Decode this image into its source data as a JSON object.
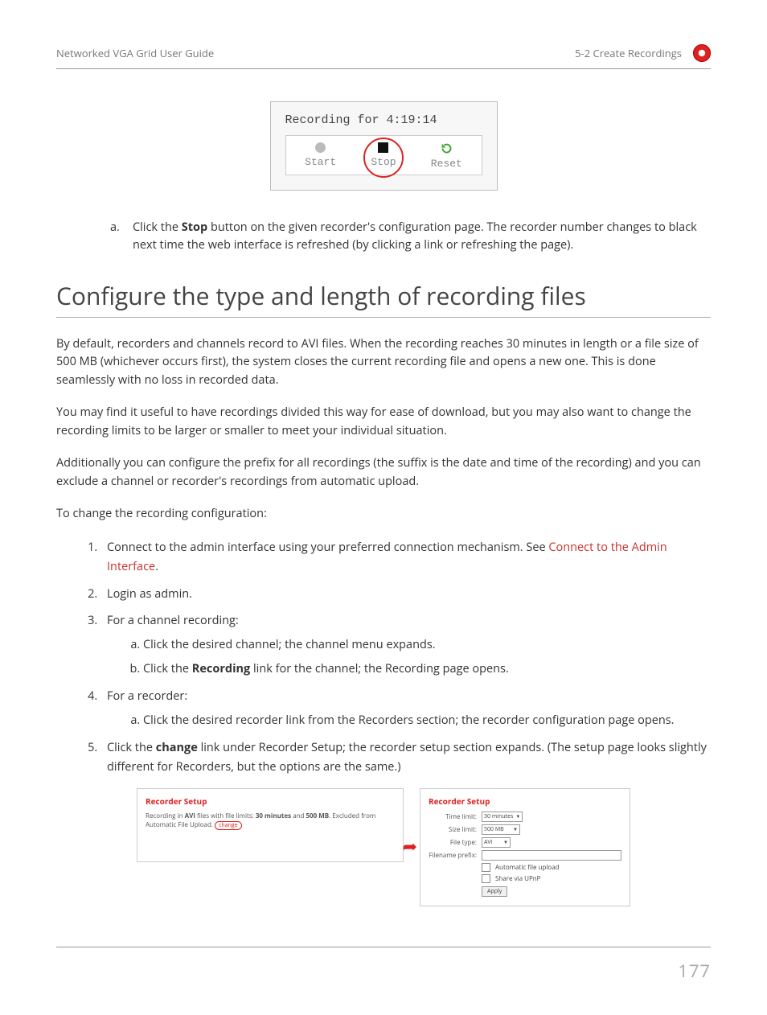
{
  "header": {
    "left": "Networked VGA Grid User Guide",
    "right": "5-2 Create Recordings"
  },
  "rec_panel": {
    "title": "Recording for 4:19:14",
    "start": "Start",
    "stop": "Stop",
    "reset": "Reset"
  },
  "step_a": {
    "marker": "a.",
    "prefix": "Click the ",
    "bold": "Stop",
    "suffix": " button on the given recorder's configuration page. The recorder number changes to black next time the web interface is refreshed (by clicking a link or refreshing the page)."
  },
  "h2": "Configure the type and length of recording files",
  "para1": "By default, recorders and channels record to AVI files.  When the recording reaches 30 minutes in length or a file size of 500  MB (whichever occurs first), the system closes the current recording file and opens a new one. This is done seamlessly with no loss in recorded data.",
  "para2": "You may find it useful to have recordings divided this way for ease of download, but you may also want to change the recording limits to be larger or smaller to meet your individual situation.",
  "para3": "Additionally you can configure the prefix for all recordings (the suffix is the date and time of the recording) and you can exclude a channel or recorder's recordings from automatic upload.",
  "para4": "To change the recording configuration:",
  "steps": {
    "s1_prefix": "Connect to the admin interface using your preferred connection mechanism. See ",
    "s1_link": "Connect to the Admin Interface",
    "s1_suffix": ".",
    "s2": "Login as admin.",
    "s3": "For a channel recording:",
    "s3a": "Click the desired channel; the channel menu expands.",
    "s3b_prefix": "Click the ",
    "s3b_bold": "Recording",
    "s3b_suffix": " link for the channel; the Recording page opens.",
    "s4": "For a recorder:",
    "s4a": "Click the desired recorder link from the Recorders section; the recorder configuration page opens.",
    "s5_prefix": "Click the ",
    "s5_bold": "change",
    "s5_suffix": " link under Recorder Setup; the recorder setup section expands. (The setup page looks slightly different for Recorders, but the options are the same.)"
  },
  "setup_left": {
    "title": "Recorder Setup",
    "line_prefix": "Recording in ",
    "line_bold1": "AVI",
    "line_mid1": " files with file limits: ",
    "line_bold2": "30 minutes",
    "line_mid2": " and ",
    "line_bold3": "500 MB",
    "line_mid3": ". Excluded from Automatic File Upload. ",
    "change": "change"
  },
  "setup_right": {
    "title": "Recorder Setup",
    "time_limit_label": "Time limit:",
    "time_limit_value": "30 minutes",
    "size_limit_label": "Size limit:",
    "size_limit_value": "500 MB",
    "file_type_label": "File type:",
    "file_type_value": "AVI",
    "prefix_label": "Filename prefix:",
    "auto_upload": "Automatic file upload",
    "share_upnp": "Share via UPnP",
    "apply": "Apply"
  },
  "page_number": "177"
}
